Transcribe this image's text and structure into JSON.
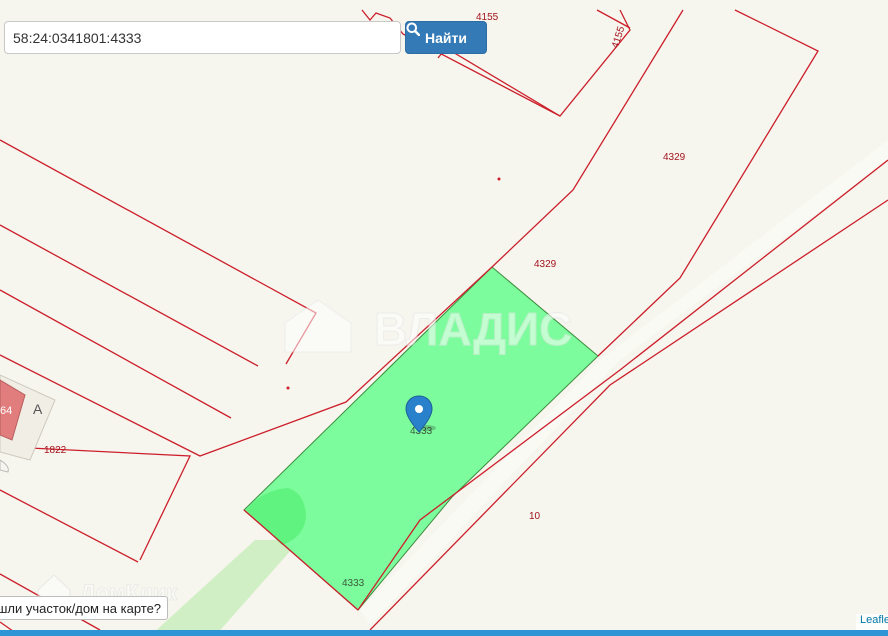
{
  "search": {
    "value": "58:24:0341801:4333"
  },
  "search_button": {
    "label": "Найти",
    "icon": "search-icon",
    "color": "#337ab7"
  },
  "parcel_labels": {
    "p4155_top": "4155",
    "p4155_side": "4155",
    "p4329_upper": "4329",
    "p4329_lower": "4329",
    "p4333_center": "4333",
    "p4333_bottom": "4333",
    "p1822": "1822",
    "p10": "10",
    "building_number": "64",
    "building_letter": "А"
  },
  "watermarks": {
    "vladis": "ВЛАДИС",
    "domclick": "ДомКлик"
  },
  "found_button": {
    "label": "шли участок/дом на карте?"
  },
  "attribution": {
    "text": "Leaflet"
  },
  "colors": {
    "selected_parcel_fill": "#7dfc9d",
    "parcel_border": "#cc1f2b",
    "marker": "#2a81cb",
    "building": "#e27d7d"
  }
}
